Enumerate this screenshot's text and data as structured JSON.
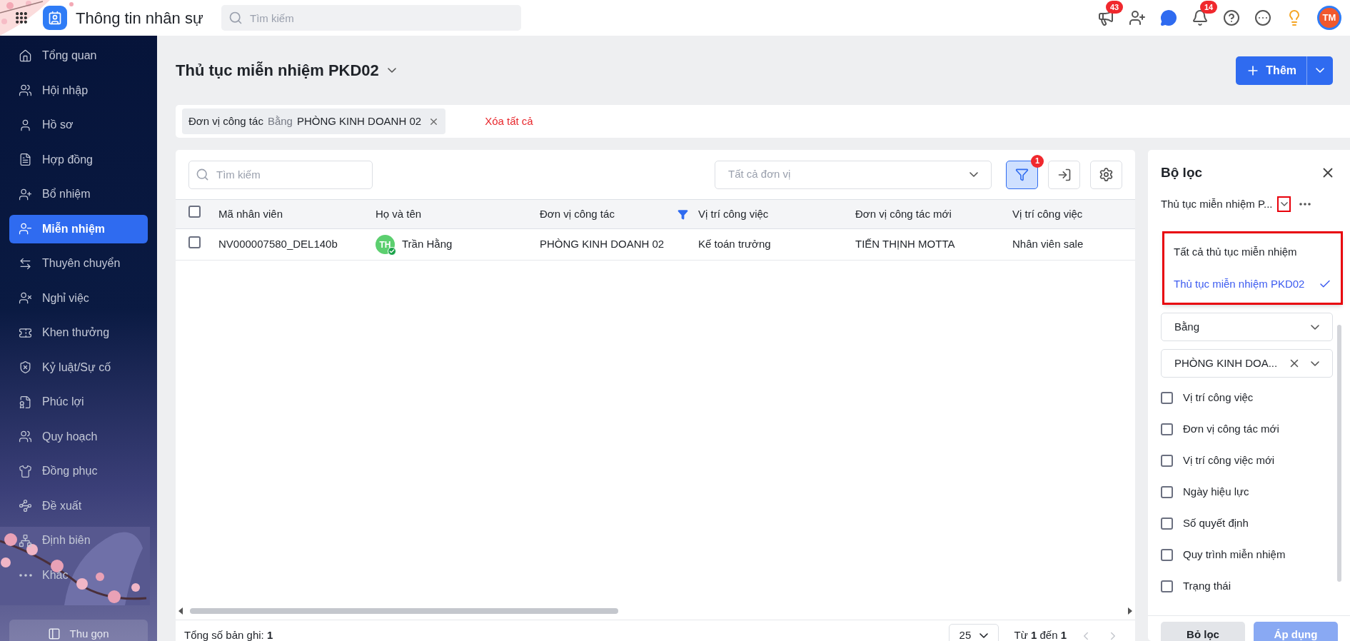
{
  "topbar": {
    "app_title": "Thông tin nhân sự",
    "search_placeholder": "Tìm kiếm",
    "badges": [
      {
        "kind": "megaphone",
        "count": "43"
      },
      {
        "kind": "add-user"
      },
      {
        "kind": "chat"
      },
      {
        "kind": "bell",
        "count": "14"
      },
      {
        "kind": "help"
      },
      {
        "kind": "more"
      },
      {
        "kind": "idea"
      }
    ],
    "avatar": "TM"
  },
  "sidebar": {
    "items": [
      {
        "label": "Tổng quan",
        "selected": false
      },
      {
        "label": "Hội nhập",
        "selected": false
      },
      {
        "label": "Hồ sơ",
        "selected": false
      },
      {
        "label": "Hợp đồng",
        "selected": false
      },
      {
        "label": "Bổ nhiệm",
        "selected": false
      },
      {
        "label": "Miễn nhiệm",
        "selected": true
      },
      {
        "label": "Thuyên chuyển",
        "selected": false
      },
      {
        "label": "Nghỉ việc",
        "selected": false
      },
      {
        "label": "Khen thưởng",
        "selected": false
      },
      {
        "label": "Kỷ luật/Sự cố",
        "selected": false
      },
      {
        "label": "Phúc lợi",
        "selected": false
      },
      {
        "label": "Quy hoạch",
        "selected": false
      },
      {
        "label": "Đồng phục",
        "selected": false
      },
      {
        "label": "Đề xuất",
        "selected": false
      },
      {
        "label": "Định biên",
        "selected": false
      },
      {
        "label": "Khác",
        "selected": false
      }
    ],
    "collapse": "Thu gọn"
  },
  "page": {
    "title": "Thủ tục miễn nhiệm PKD02",
    "add_button": "Thêm"
  },
  "active_filters": {
    "chips": [
      {
        "field": "Đơn vị công tác",
        "operator": "Bằng",
        "value": "PHÒNG KINH DOANH 02"
      }
    ],
    "clear_all": "Xóa tất cả"
  },
  "table": {
    "search_placeholder": "Tìm kiếm",
    "unit_placeholder": "Tất cả đơn vị",
    "filter_count": "1",
    "header_checked": false,
    "columns": [
      {
        "label": "Mã nhân viên",
        "filtered": false
      },
      {
        "label": "Họ và tên",
        "filtered": false
      },
      {
        "label": "Đơn vị công tác",
        "filtered": true
      },
      {
        "label": "Vị trí công việc",
        "filtered": false
      },
      {
        "label": "Đơn vị công tác mới",
        "filtered": false
      },
      {
        "label": "Vị trí công việc",
        "filtered": false
      }
    ],
    "rows": [
      {
        "checked": false,
        "cells": [
          "NV000007580_DEL140b",
          "Trần Hằng",
          "PHÒNG KINH DOANH 02",
          "Kế toán trưởng",
          "TIẾN THỊNH MOTTA",
          "Nhân viên sale"
        ],
        "initials": "TH",
        "verified": true
      }
    ],
    "total": "Tổng số bản ghi: **1**",
    "page_size": "25",
    "range": "Từ **1** đến **1**"
  },
  "filter_panel": {
    "title": "Bộ lọc",
    "saved_filter": "Thủ tục miễn nhiệm P...",
    "options": [
      {
        "label": "Tất cả thủ tục miễn nhiệm",
        "selected": false
      },
      {
        "label": "Thủ tục miễn nhiệm PKD02",
        "selected": true
      }
    ],
    "operator": "Bằng",
    "value": "PHÒNG KINH DOA...",
    "fields": [
      {
        "label": "Vị trí công việc",
        "checked": false
      },
      {
        "label": "Đơn vị công tác mới",
        "checked": false
      },
      {
        "label": "Vị trí công việc mới",
        "checked": false
      },
      {
        "label": "Ngày hiệu lực",
        "checked": false
      },
      {
        "label": "Số quyết định",
        "checked": false
      },
      {
        "label": "Quy trình miễn nhiệm",
        "checked": false
      },
      {
        "label": "Trạng thái",
        "checked": false
      }
    ],
    "reset": "Bỏ lọc",
    "apply": "Áp dụng"
  }
}
